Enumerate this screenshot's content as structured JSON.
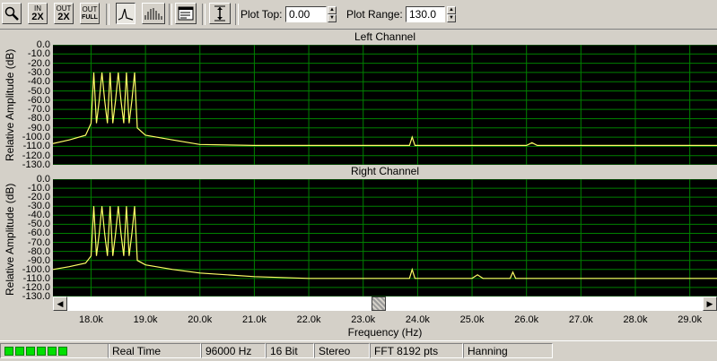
{
  "toolbar": {
    "buttons": [
      {
        "name": "zoom-button",
        "icon": "magnifier-icon"
      },
      {
        "name": "zoom-in-2x-button",
        "top": "IN",
        "bottom": "2X"
      },
      {
        "name": "zoom-out-2x-button",
        "top": "OUT",
        "bottom": "2X"
      },
      {
        "name": "zoom-out-full-button",
        "top": "OUT",
        "bottom": "FULL"
      },
      {
        "name": "line-plot-button",
        "icon": "line-spectrum-icon"
      },
      {
        "name": "bar-plot-button",
        "icon": "bar-spectrum-icon"
      },
      {
        "name": "settings-panel-button",
        "icon": "panel-icon"
      },
      {
        "name": "autoscale-button",
        "icon": "vertical-scale-icon"
      }
    ],
    "plot_top_label": "Plot Top:",
    "plot_top_value": "0.00",
    "plot_range_label": "Plot Range:",
    "plot_range_value": "130.0"
  },
  "left_channel": {
    "title": "Left Channel"
  },
  "right_channel": {
    "title": "Right Channel"
  },
  "y_axis_label": "Relative Amplitude (dB)",
  "y_tick_labels": [
    "0.0",
    "-10.0",
    "-20.0",
    "-30.0",
    "-40.0",
    "-50.0",
    "-60.0",
    "-70.0",
    "-80.0",
    "-90.0",
    "-100.0",
    "-110.0",
    "-120.0",
    "-130.0"
  ],
  "x_axis_label": "Frequency (Hz)",
  "x_tick_labels": [
    "18.0k",
    "19.0k",
    "20.0k",
    "21.0k",
    "22.0k",
    "23.0k",
    "24.0k",
    "25.0k",
    "26.0k",
    "27.0k",
    "28.0k",
    "29.0k"
  ],
  "scroll_position": 0.49,
  "status": {
    "meter_segments": 6,
    "mode": "Real Time",
    "sample_rate": "96000 Hz",
    "bit_depth": "16 Bit",
    "channels": "Stereo",
    "fft": "FFT 8192 pts",
    "window": "Hanning"
  },
  "colors": {
    "plot_bg": "#000000",
    "grid": "#008000",
    "trace": "#ffff66"
  },
  "chart_data": {
    "type": "line",
    "xlim": [
      17.3,
      29.5
    ],
    "ylim": [
      -130,
      0
    ],
    "x_units": "kHz",
    "grid": true,
    "series": [
      {
        "x": [
          17.3,
          17.6,
          17.9,
          18.0,
          18.05,
          18.1,
          18.15,
          18.2,
          18.25,
          18.3,
          18.35,
          18.4,
          18.45,
          18.5,
          18.55,
          18.6,
          18.65,
          18.7,
          18.75,
          18.8,
          18.85,
          19.0,
          19.5,
          20.0,
          21.0,
          22.0,
          23.0,
          23.85,
          23.9,
          23.95,
          24.5,
          25.0,
          26.0,
          26.1,
          26.2,
          27.0,
          28.0,
          29.0,
          29.5
        ],
        "y": [
          -107,
          -103,
          -98,
          -85,
          -30,
          -85,
          -60,
          -30,
          -60,
          -85,
          -30,
          -85,
          -60,
          -30,
          -60,
          -85,
          -30,
          -85,
          -60,
          -30,
          -90,
          -98,
          -103,
          -108,
          -109,
          -109,
          -109,
          -109,
          -100,
          -109,
          -109,
          -109,
          -109,
          -106,
          -109,
          -109,
          -109,
          -109,
          -109
        ]
      },
      {
        "x": [
          17.3,
          17.6,
          17.9,
          18.0,
          18.05,
          18.1,
          18.15,
          18.2,
          18.25,
          18.3,
          18.35,
          18.4,
          18.45,
          18.5,
          18.55,
          18.6,
          18.65,
          18.7,
          18.75,
          18.8,
          18.85,
          19.0,
          19.5,
          20.0,
          21.0,
          22.0,
          23.0,
          23.85,
          23.9,
          23.95,
          25.0,
          25.1,
          25.2,
          25.7,
          25.75,
          25.8,
          26.0,
          27.0,
          28.0,
          29.0,
          29.5
        ],
        "y": [
          -100,
          -97,
          -93,
          -85,
          -30,
          -85,
          -60,
          -30,
          -60,
          -85,
          -30,
          -85,
          -60,
          -30,
          -60,
          -85,
          -30,
          -85,
          -60,
          -30,
          -90,
          -95,
          -100,
          -104,
          -108,
          -110,
          -110,
          -110,
          -100,
          -110,
          -110,
          -106,
          -110,
          -110,
          -103,
          -110,
          -110,
          -110,
          -110,
          -110,
          -110
        ]
      }
    ]
  }
}
